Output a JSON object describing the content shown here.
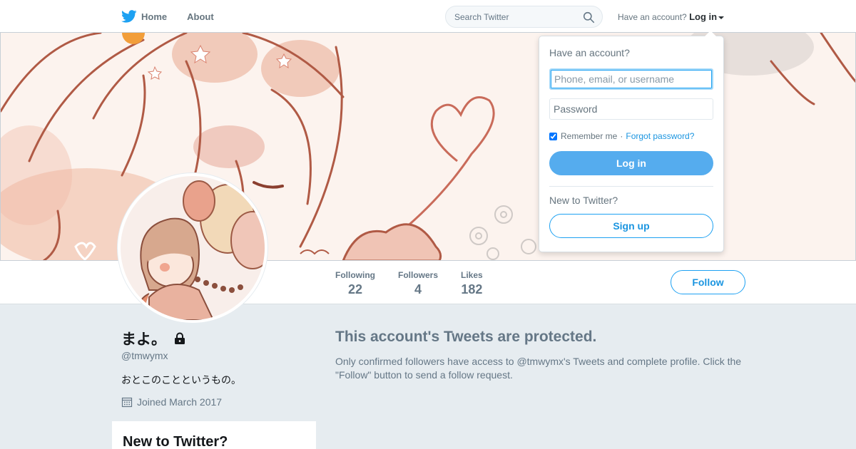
{
  "nav": {
    "home_label": "Home",
    "about_label": "About",
    "search_placeholder": "Search Twitter",
    "account_prompt": "Have an account?",
    "login_label": "Log in"
  },
  "profile": {
    "name": "まよ。",
    "handle": "@tmwymx",
    "bio": "おとこのことというもの。",
    "joined": "Joined March 2017",
    "stats": [
      {
        "label": "Following",
        "value": "22"
      },
      {
        "label": "Followers",
        "value": "4"
      },
      {
        "label": "Likes",
        "value": "182"
      }
    ],
    "follow_label": "Follow"
  },
  "protected": {
    "title": "This account's Tweets are protected.",
    "message": "Only confirmed followers have access to @tmwymx's Tweets and complete profile. Click the \"Follow\" button to send a follow request."
  },
  "sidebar_card": {
    "title": "New to Twitter?"
  },
  "login_dropdown": {
    "heading": "Have an account?",
    "username_placeholder": "Phone, email, or username",
    "password_placeholder": "Password",
    "remember_label": "Remember me",
    "separator": "·",
    "forgot_label": "Forgot password?",
    "login_button": "Log in",
    "new_heading": "New to Twitter?",
    "signup_button": "Sign up"
  },
  "colors": {
    "twitter_blue": "#1da1f2",
    "login_button_bg": "#55acee",
    "page_bg": "#e6ecf0",
    "muted_text": "#657786"
  },
  "icons": {
    "logo": "twitter-bird-icon",
    "search": "search-icon",
    "lock": "lock-icon",
    "calendar": "calendar-icon"
  }
}
